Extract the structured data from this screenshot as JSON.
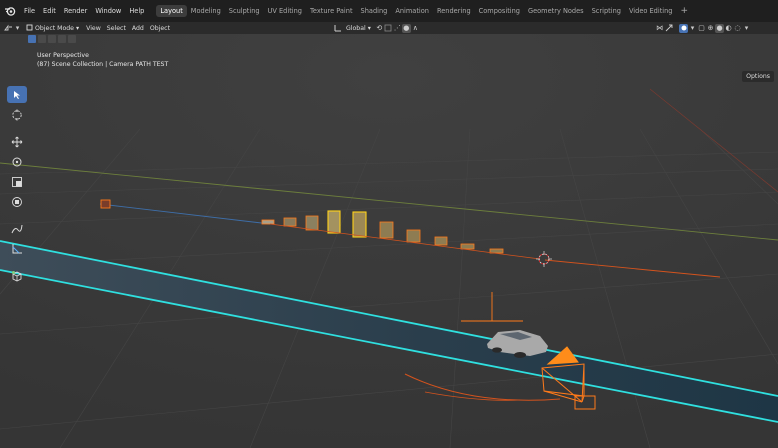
{
  "menu": {
    "items": [
      "File",
      "Edit",
      "Render",
      "Window",
      "Help"
    ]
  },
  "workspaces": {
    "tabs": [
      "Layout",
      "Modeling",
      "Sculpting",
      "UV Editing",
      "Texture Paint",
      "Shading",
      "Animation",
      "Rendering",
      "Compositing",
      "Geometry Nodes",
      "Scripting",
      "Video Editing"
    ],
    "active": "Layout",
    "add_label": "+"
  },
  "header": {
    "mode_label": "Object Mode",
    "view_label": "View",
    "select_label": "Select",
    "add_label": "Add",
    "object_label": "Object",
    "transform_orientation": "Global",
    "options_label": "Options"
  },
  "viewport": {
    "perspective_label": "User Perspective",
    "collection_info": "(87) Scene Collection | Camera PATH TEST"
  },
  "icons": {
    "logo": "blender-logo-icon",
    "tools": [
      "select-box-icon",
      "cursor-icon",
      "move-icon",
      "rotate-icon",
      "scale-icon",
      "transform-icon",
      "annotate-icon",
      "measure-icon",
      "add-cube-icon"
    ]
  },
  "colors": {
    "accent": "#4772b3",
    "road_edge": "#2fe0e0",
    "selection_orange": "#ff7a1a",
    "active_yellow": "#ffd21a"
  }
}
